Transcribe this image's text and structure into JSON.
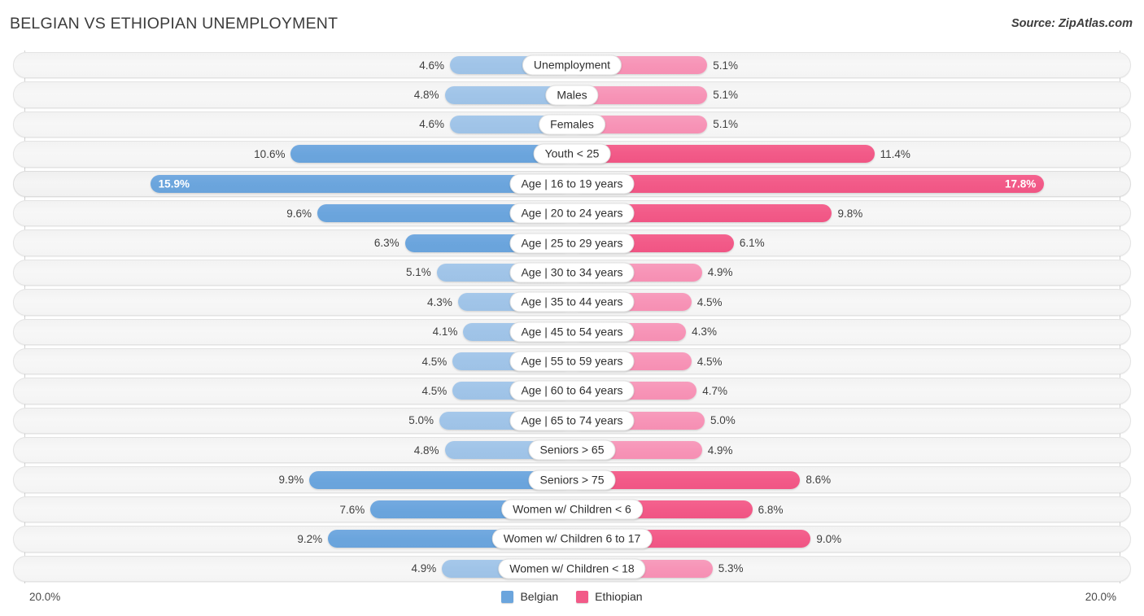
{
  "header": {
    "title": "BELGIAN VS ETHIOPIAN UNEMPLOYMENT",
    "source": "Source: ZipAtlas.com"
  },
  "footer": {
    "axis_left": "20.0%",
    "axis_right": "20.0%",
    "legend": [
      {
        "label": "Belgian",
        "color": "#6ba5dd"
      },
      {
        "label": "Ethiopian",
        "color": "#f25a88"
      }
    ]
  },
  "colors": {
    "belgian_light": "#a0c4e8",
    "belgian_strong": "#6ba5dd",
    "ethiopian_light": "#f794b7",
    "ethiopian_strong": "#f25a88"
  },
  "chart_data": {
    "type": "bar",
    "title": "BELGIAN VS ETHIOPIAN UNEMPLOYMENT",
    "subtitle": "Source: ZipAtlas.com",
    "orientation": "horizontal-diverging",
    "xlabel": "",
    "ylabel": "",
    "xlim": [
      0,
      20
    ],
    "axis_max_label": "20.0%",
    "grid": false,
    "legend_position": "bottom-center",
    "series": [
      {
        "name": "Belgian",
        "color": "#6ba5dd",
        "values": [
          4.6,
          4.8,
          4.6,
          10.6,
          15.9,
          9.6,
          6.3,
          5.1,
          4.3,
          4.1,
          4.5,
          4.5,
          5.0,
          4.8,
          9.9,
          7.6,
          9.2,
          4.9
        ]
      },
      {
        "name": "Ethiopian",
        "color": "#f25a88",
        "values": [
          5.1,
          5.1,
          5.1,
          11.4,
          17.8,
          9.8,
          6.1,
          4.9,
          4.5,
          4.3,
          4.5,
          4.7,
          5.0,
          4.9,
          8.6,
          6.8,
          9.0,
          5.3
        ]
      }
    ],
    "categories": [
      "Unemployment",
      "Males",
      "Females",
      "Youth < 25",
      "Age | 16 to 19 years",
      "Age | 20 to 24 years",
      "Age | 25 to 29 years",
      "Age | 30 to 34 years",
      "Age | 35 to 44 years",
      "Age | 45 to 54 years",
      "Age | 55 to 59 years",
      "Age | 60 to 64 years",
      "Age | 65 to 74 years",
      "Seniors > 65",
      "Seniors > 75",
      "Women w/ Children < 6",
      "Women w/ Children 6 to 17",
      "Women w/ Children < 18"
    ],
    "rows": [
      {
        "label": "Unemployment",
        "left_value": 4.6,
        "left_text": "4.6%",
        "right_value": 5.1,
        "right_text": "5.1%",
        "highlight": false
      },
      {
        "label": "Males",
        "left_value": 4.8,
        "left_text": "4.8%",
        "right_value": 5.1,
        "right_text": "5.1%",
        "highlight": false
      },
      {
        "label": "Females",
        "left_value": 4.6,
        "left_text": "4.6%",
        "right_value": 5.1,
        "right_text": "5.1%",
        "highlight": false
      },
      {
        "label": "Youth < 25",
        "left_value": 10.6,
        "left_text": "10.6%",
        "right_value": 11.4,
        "right_text": "11.4%",
        "highlight": false
      },
      {
        "label": "Age | 16 to 19 years",
        "left_value": 15.9,
        "left_text": "15.9%",
        "right_value": 17.8,
        "right_text": "17.8%",
        "highlight": true
      },
      {
        "label": "Age | 20 to 24 years",
        "left_value": 9.6,
        "left_text": "9.6%",
        "right_value": 9.8,
        "right_text": "9.8%",
        "highlight": false
      },
      {
        "label": "Age | 25 to 29 years",
        "left_value": 6.3,
        "left_text": "6.3%",
        "right_value": 6.1,
        "right_text": "6.1%",
        "highlight": false
      },
      {
        "label": "Age | 30 to 34 years",
        "left_value": 5.1,
        "left_text": "5.1%",
        "right_value": 4.9,
        "right_text": "4.9%",
        "highlight": false
      },
      {
        "label": "Age | 35 to 44 years",
        "left_value": 4.3,
        "left_text": "4.3%",
        "right_value": 4.5,
        "right_text": "4.5%",
        "highlight": false
      },
      {
        "label": "Age | 45 to 54 years",
        "left_value": 4.1,
        "left_text": "4.1%",
        "right_value": 4.3,
        "right_text": "4.3%",
        "highlight": false
      },
      {
        "label": "Age | 55 to 59 years",
        "left_value": 4.5,
        "left_text": "4.5%",
        "right_value": 4.5,
        "right_text": "4.5%",
        "highlight": false
      },
      {
        "label": "Age | 60 to 64 years",
        "left_value": 4.5,
        "left_text": "4.5%",
        "right_value": 4.7,
        "right_text": "4.7%",
        "highlight": false
      },
      {
        "label": "Age | 65 to 74 years",
        "left_value": 5.0,
        "left_text": "5.0%",
        "right_value": 5.0,
        "right_text": "5.0%",
        "highlight": false
      },
      {
        "label": "Seniors > 65",
        "left_value": 4.8,
        "left_text": "4.8%",
        "right_value": 4.9,
        "right_text": "4.9%",
        "highlight": false
      },
      {
        "label": "Seniors > 75",
        "left_value": 9.9,
        "left_text": "9.9%",
        "right_value": 8.6,
        "right_text": "8.6%",
        "highlight": false
      },
      {
        "label": "Women w/ Children < 6",
        "left_value": 7.6,
        "left_text": "7.6%",
        "right_value": 6.8,
        "right_text": "6.8%",
        "highlight": false
      },
      {
        "label": "Women w/ Children 6 to 17",
        "left_value": 9.2,
        "left_text": "9.2%",
        "right_value": 9.0,
        "right_text": "9.0%",
        "highlight": false
      },
      {
        "label": "Women w/ Children < 18",
        "left_value": 4.9,
        "left_text": "4.9%",
        "right_value": 5.3,
        "right_text": "5.3%",
        "highlight": false
      }
    ]
  }
}
